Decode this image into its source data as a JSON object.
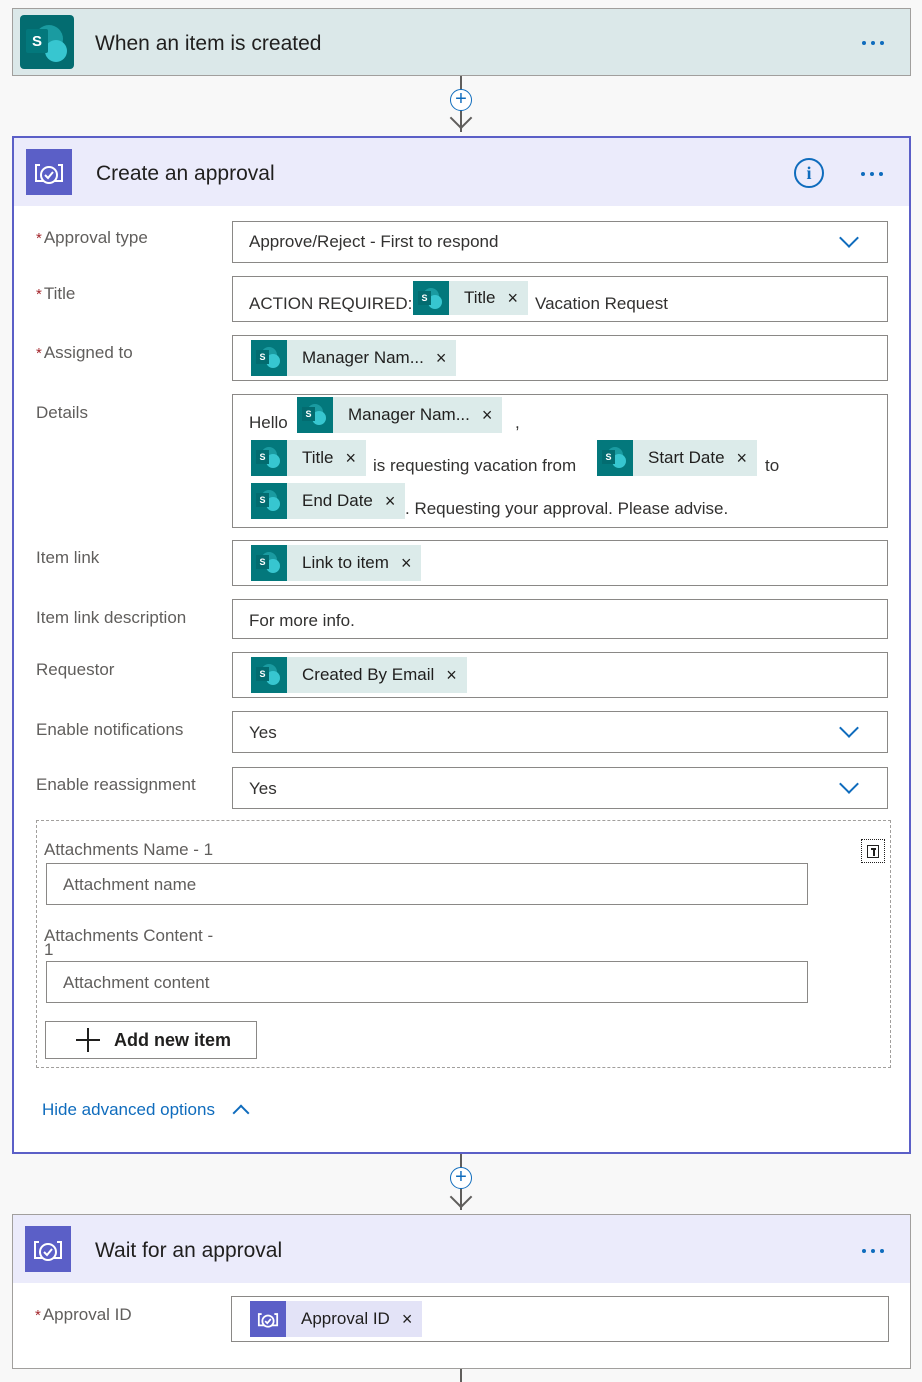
{
  "trigger": {
    "title": "When an item is created"
  },
  "approval": {
    "title": "Create an approval",
    "required_mark": "*",
    "fields": {
      "approval_type": {
        "label": "Approval type",
        "value": "Approve/Reject - First to respond"
      },
      "title": {
        "label": "Title",
        "prefix": "ACTION REQUIRED:",
        "token": "Title",
        "suffix": "Vacation Request"
      },
      "assigned_to": {
        "label": "Assigned to",
        "token": "Manager Nam..."
      },
      "details": {
        "label": "Details",
        "hello": "Hello",
        "token_manager": "Manager Nam...",
        "comma": ",",
        "token_title": "Title",
        "requesting": "is requesting vacation from",
        "token_start": "Start Date",
        "to": "to",
        "token_end": "End Date",
        "closing": ". Requesting your approval. Please advise."
      },
      "item_link": {
        "label": "Item link",
        "token": "Link to item"
      },
      "item_link_description": {
        "label": "Item link description",
        "value": "For more info."
      },
      "requestor": {
        "label": "Requestor",
        "token": "Created By Email"
      },
      "enable_notifications": {
        "label": "Enable notifications",
        "value": "Yes"
      },
      "enable_reassignment": {
        "label": "Enable reassignment",
        "value": "Yes"
      }
    },
    "attachments": {
      "name_label": "Attachments Name - 1",
      "name_placeholder": "Attachment name",
      "content_label_line1": "Attachments Content -",
      "content_label_line2": "1",
      "content_placeholder": "Attachment content",
      "add_button": "Add new item"
    },
    "hide_advanced": "Hide advanced options"
  },
  "wait": {
    "title": "Wait for an approval",
    "fields": {
      "approval_id": {
        "label": "Approval ID",
        "token": "Approval ID"
      }
    }
  },
  "token_close": "×",
  "sp_letter": "S",
  "colors": {
    "accent": "#0f6cbd",
    "approval_header": "#ebebfb",
    "trigger_header": "#dbe8e9",
    "sharepoint": "#036c70",
    "approvals": "#5b5fc7"
  }
}
